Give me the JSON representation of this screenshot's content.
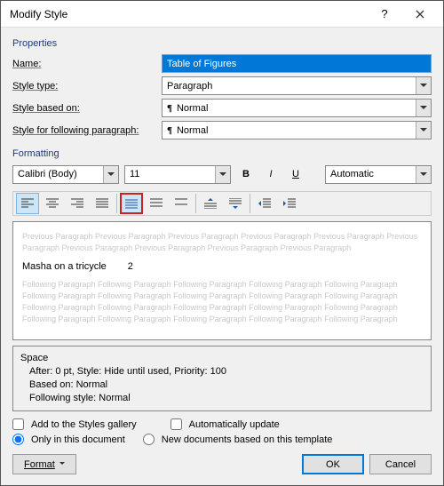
{
  "title": "Modify Style",
  "sections": {
    "properties": "Properties",
    "formatting": "Formatting"
  },
  "labels": {
    "name": "Name:",
    "styleType": "Style type:",
    "basedOn": "Style based on:",
    "following": "Style for following paragraph:",
    "addGallery": "Add to the Styles gallery",
    "autoUpdate": "Automatically update",
    "onlyDoc": "Only in this document",
    "newDocs": "New documents based on this template"
  },
  "values": {
    "name": "Table of Figures",
    "styleType": "Paragraph",
    "basedOn": "Normal",
    "following": "Normal",
    "font": "Calibri (Body)",
    "size": "11",
    "color": "Automatic"
  },
  "preview": {
    "ghost_prev": "Previous Paragraph Previous Paragraph Previous Paragraph Previous Paragraph Previous Paragraph Previous",
    "ghost_prev2": "Paragraph Previous Paragraph Previous Paragraph Previous Paragraph Previous Paragraph",
    "sample_text": "Masha on a tricycle",
    "sample_num": "2",
    "ghost_next": "Following Paragraph Following Paragraph Following Paragraph Following Paragraph Following Paragraph"
  },
  "desc": {
    "l1": "Space",
    "l2": "After:  0 pt, Style: Hide until used, Priority: 100",
    "l3": "Based on: Normal",
    "l4": "Following style: Normal"
  },
  "buttons": {
    "format": "Format",
    "ok": "OK",
    "cancel": "Cancel"
  },
  "toolbar_icons": {
    "bold": "B",
    "italic": "I",
    "underline": "U"
  }
}
